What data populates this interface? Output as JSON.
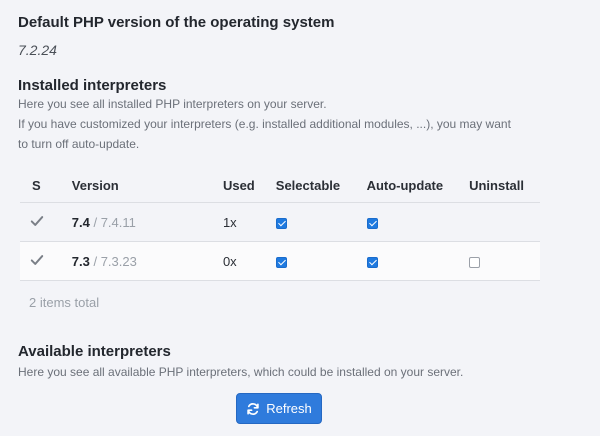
{
  "default_section": {
    "title": "Default PHP version of the operating system",
    "version": "7.2.24"
  },
  "installed_section": {
    "title": "Installed interpreters",
    "description_line1": "Here you see all installed PHP interpreters on your server.",
    "description_line2": "If you have customized your interpreters (e.g. installed additional modules, ...), you may want",
    "description_line3": "to turn off auto-update.",
    "columns": {
      "s": "S",
      "version": "Version",
      "used": "Used",
      "selectable": "Selectable",
      "auto_update": "Auto-update",
      "uninstall": "Uninstall"
    },
    "rows": [
      {
        "status_icon": "check-icon",
        "major": "7.4",
        "separator": " / ",
        "full": "7.4.11",
        "used": "1x",
        "selectable": true,
        "auto_update": true,
        "uninstall": null
      },
      {
        "status_icon": "check-icon",
        "major": "7.3",
        "separator": " / ",
        "full": "7.3.23",
        "used": "0x",
        "selectable": true,
        "auto_update": true,
        "uninstall": false
      }
    ],
    "total": "2 items total"
  },
  "available_section": {
    "title": "Available interpreters",
    "description": "Here you see all available PHP interpreters, which could be installed on your server."
  },
  "refresh_button": {
    "label": "Refresh",
    "icon": "refresh-icon"
  },
  "colors": {
    "accent": "#2f7bdc",
    "checkbox": "#1f7ae0",
    "background": "#f3f4f8"
  }
}
